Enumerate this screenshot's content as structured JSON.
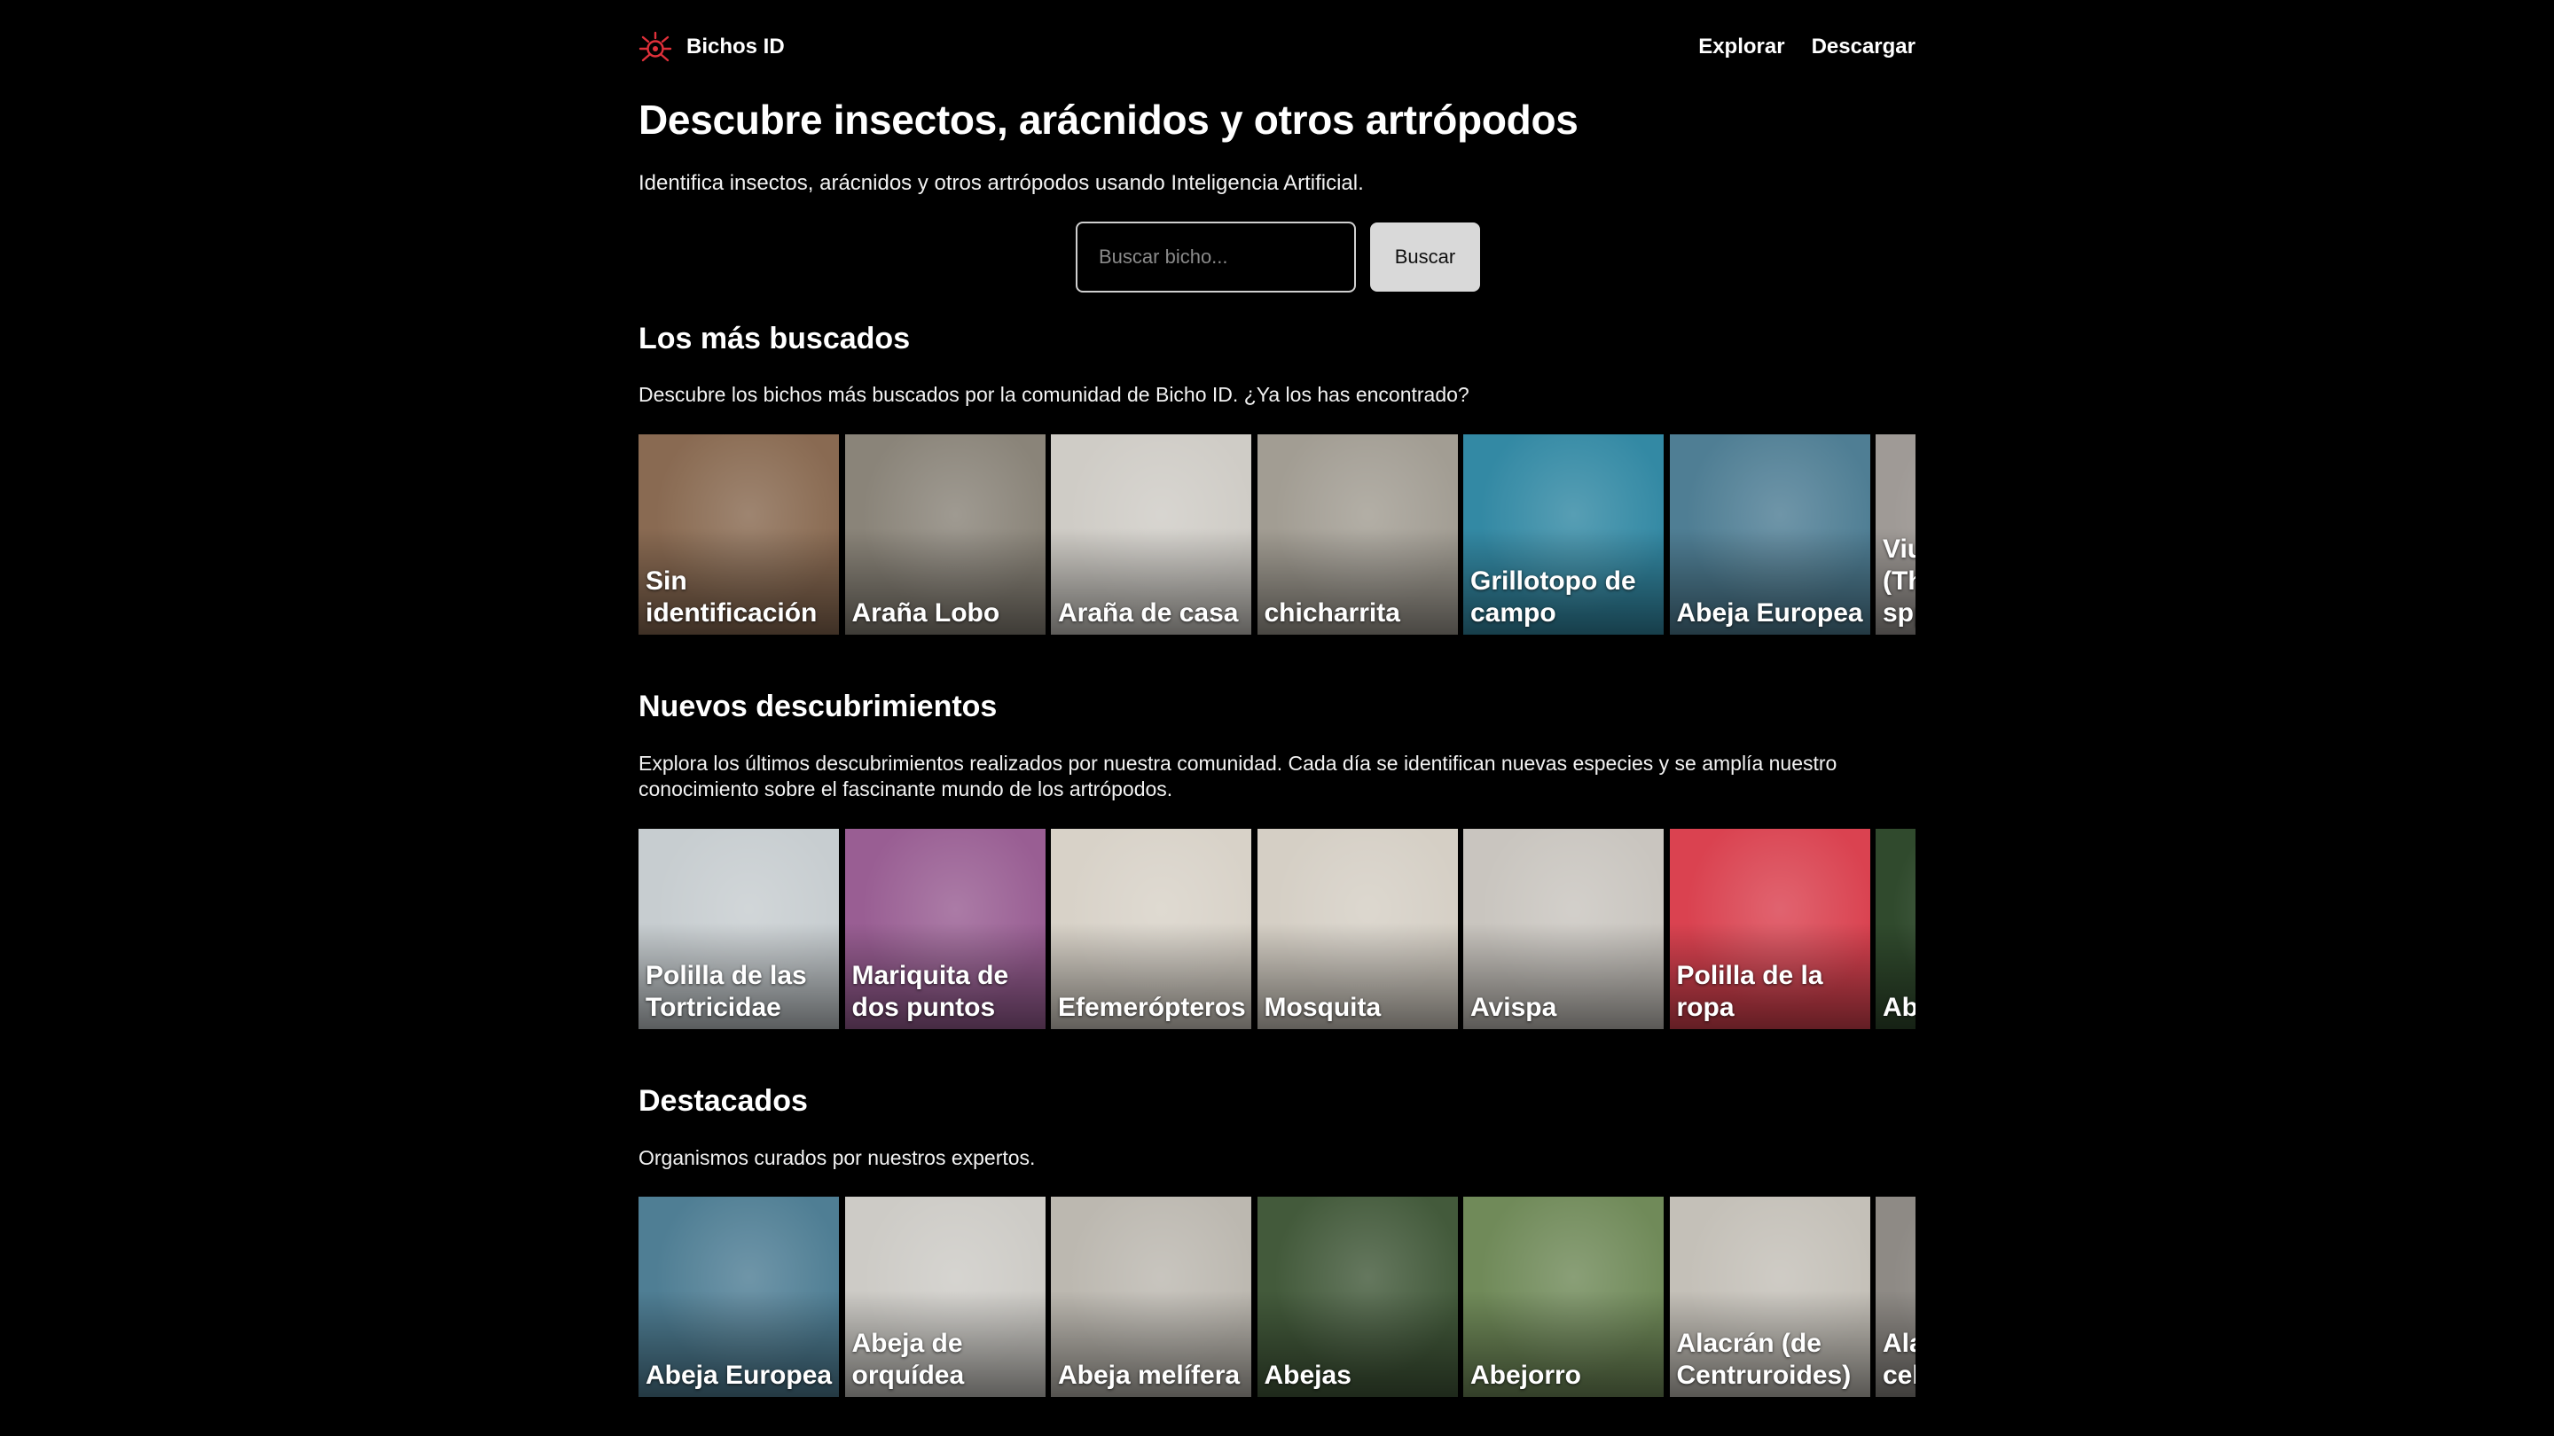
{
  "nav": {
    "brand": "Bichos ID",
    "links": [
      "Explorar",
      "Descargar"
    ]
  },
  "hero": {
    "title": "Descubre insectos, arácnidos y otros artrópodos",
    "subtitle": "Identifica insectos, arácnidos y otros artrópodos usando Inteligencia Artificial."
  },
  "search": {
    "placeholder": "Buscar bicho...",
    "button": "Buscar"
  },
  "colors": {
    "background": "#000000",
    "text": "#ffffff",
    "brand_accent": "#e0303a",
    "button_bg": "#d9d9d9"
  },
  "sections": [
    {
      "title": "Los más buscados",
      "description": "Descubre los bichos más buscados por la comunidad de Bicho ID. ¿Ya los has encontrado?",
      "cards": [
        {
          "label": "Sin identificación",
          "bg": "#8a6a50"
        },
        {
          "label": "Araña Lobo",
          "bg": "#8a8478"
        },
        {
          "label": "Araña de casa",
          "bg": "#cfccc6"
        },
        {
          "label": "chicharrita",
          "bg": "#a29d92"
        },
        {
          "label": "Grillotopo de campo",
          "bg": "#2f8aa6"
        },
        {
          "label": "Abeja Europea",
          "bg": "#4d7e96"
        },
        {
          "label": "Viuda negra (Theridiidae spp.)",
          "bg": "#9f9a96"
        }
      ]
    },
    {
      "title": "Nuevos descubrimientos",
      "description": "Explora los últimos descubrimientos realizados por nuestra comunidad. Cada día se identifican nuevas especies y se amplía nuestro conocimiento sobre el fascinante mundo de los artrópodos.",
      "cards": [
        {
          "label": "Polilla de las Tortricidae",
          "bg": "#c7cdd0"
        },
        {
          "label": "Mariquita de dos puntos",
          "bg": "#9b5d95"
        },
        {
          "label": "Efemerópteros",
          "bg": "#d8d2c7"
        },
        {
          "label": "Mosquita",
          "bg": "#d5cfc4"
        },
        {
          "label": "Avispa",
          "bg": "#c9c5bf"
        },
        {
          "label": "Polilla de la ropa",
          "bg": "#e0404f"
        },
        {
          "label": "Abeja",
          "bg": "#2f4a2c"
        }
      ]
    },
    {
      "title": "Destacados",
      "description": "Organismos curados por nuestros expertos.",
      "cards": [
        {
          "label": "Abeja Europea",
          "bg": "#4d7e96"
        },
        {
          "label": "Abeja de orquídea",
          "bg": "#cdcbc6"
        },
        {
          "label": "Abeja melífera",
          "bg": "#bcb8b0"
        },
        {
          "label": "Abejas",
          "bg": "#425a3a"
        },
        {
          "label": "Abejorro",
          "bg": "#6f8a57"
        },
        {
          "label": "Alacrán (de Centruroides)",
          "bg": "#c4c0b8"
        },
        {
          "label": "Alacrán de celda",
          "bg": "#8e8a85"
        }
      ]
    }
  ]
}
